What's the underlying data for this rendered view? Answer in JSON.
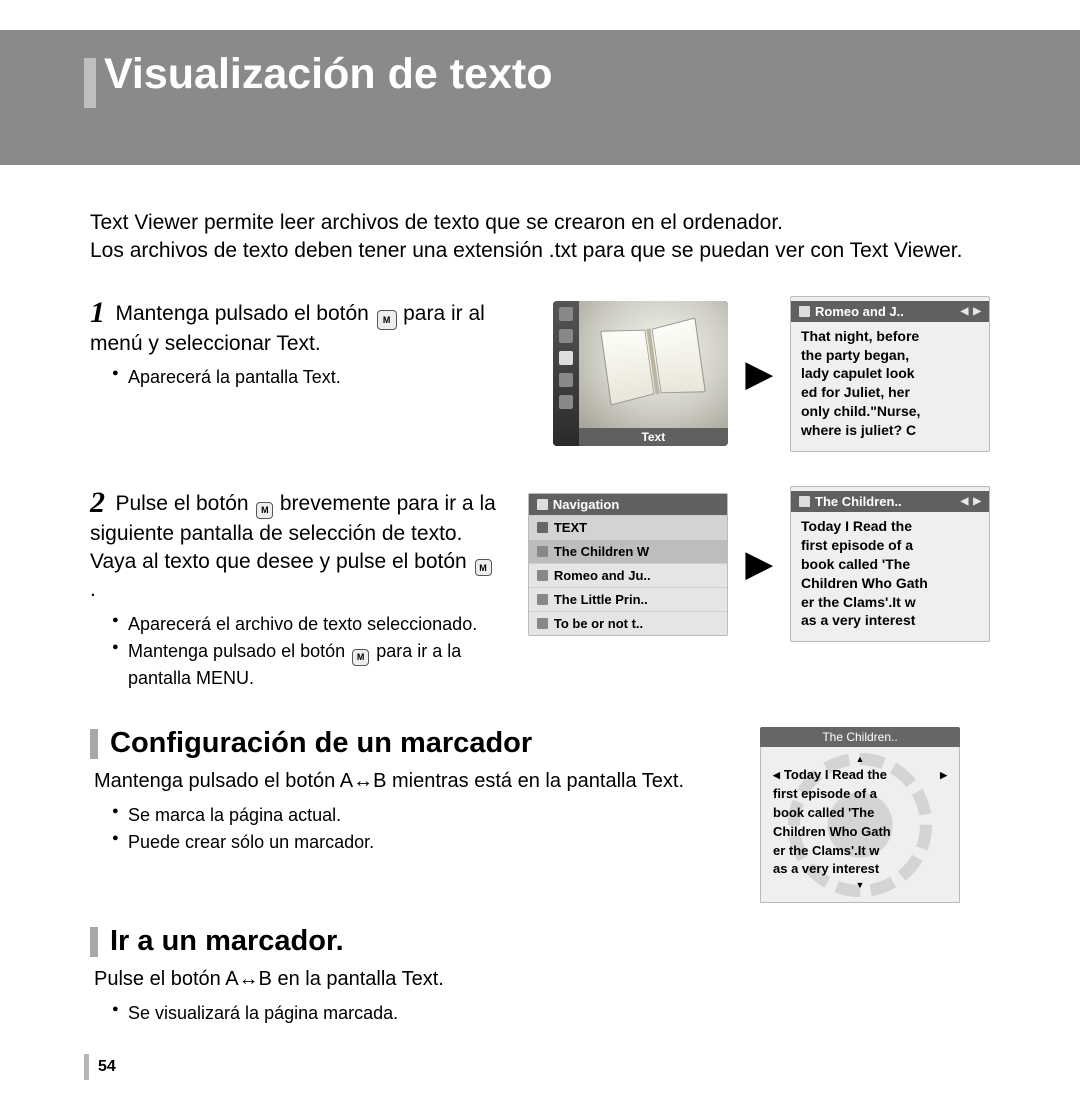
{
  "header": {
    "title": "Visualización de texto"
  },
  "intro": {
    "l1": "Text Viewer permite leer archivos de texto que se crearon en el ordenador.",
    "l2": "Los archivos de texto deben tener una extensión .txt para que se puedan ver con Text Viewer."
  },
  "step1": {
    "num": "1",
    "pre": "Mantenga pulsado el botón ",
    "post": " para ir al menú y seleccionar Text.",
    "bullet1": "Aparecerá la pantalla Text."
  },
  "screen1": {
    "footer": "Text",
    "tp_title": "Romeo and J..",
    "tp_lines": [
      "That night, before",
      "the party began,",
      "lady capulet look",
      "ed for Juliet, her",
      "only child.\"Nurse,",
      "where is juliet? C"
    ]
  },
  "step2": {
    "num": "2",
    "pre": "Pulse el botón ",
    "mid": " brevemente para ir a la siguiente pantalla de selección de texto. Vaya al texto que desee y pulse el botón ",
    "post": ".",
    "bullet1": "Aparecerá el archivo de texto seleccionado.",
    "bullet2_pre": "Mantenga pulsado el botón ",
    "bullet2_post": " para ir a la pantalla MENU."
  },
  "nav": {
    "title": "Navigation",
    "rows": [
      "TEXT",
      "The Children W",
      "Romeo and Ju..",
      "The Little Prin..",
      "To be or not t.."
    ]
  },
  "screen2b": {
    "tp_title": "The Children..",
    "tp_lines": [
      "Today I Read the",
      "first episode of a",
      "book called 'The",
      "Children Who Gath",
      "er the Clams'.It w",
      "as a very interest"
    ]
  },
  "sec_bookmark": {
    "title": "Configuración de un marcador",
    "body": "Mantenga pulsado el botón A↔B  mientras está en la pantalla Text.",
    "b1": "Se marca la página actual.",
    "b2": "Puede crear sólo un marcador."
  },
  "bookmark_screen": {
    "title": "The Children..",
    "lines": [
      "Today I Read the",
      "first episode of a",
      "book called 'The",
      "Children Who Gath",
      "er the Clams'.It w",
      "as a very interest"
    ]
  },
  "sec_goto": {
    "title": "Ir a un marcador.",
    "body": "Pulse el botón  A↔B  en la pantalla Text.",
    "b1": "Se visualizará la página marcada."
  },
  "page_number": "54",
  "btn_label": "M"
}
